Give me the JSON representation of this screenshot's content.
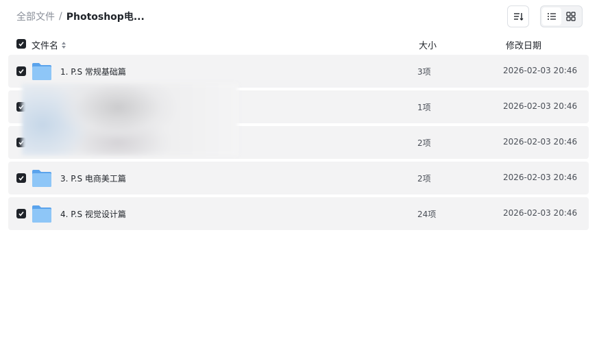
{
  "breadcrumb": {
    "root": "全部文件",
    "separator": "/",
    "current": "Photoshop电..."
  },
  "toolbar": {
    "sort_icon": "sort-icon",
    "list_view_icon": "list-view-icon",
    "grid_view_icon": "grid-view-icon",
    "active_view": "list"
  },
  "columns": {
    "name": "文件名",
    "size": "大小",
    "date": "修改日期"
  },
  "files": [
    {
      "name": "1. P.S 常规基础篇",
      "size": "3项",
      "date": "2026-02-03 20:46",
      "checked": true
    },
    {
      "name": "",
      "size": "1项",
      "date": "2026-02-03 20:46",
      "checked": true
    },
    {
      "name": "",
      "size": "2项",
      "date": "2026-02-03 20:46",
      "checked": true
    },
    {
      "name": "3. P.S 电商美工篇",
      "size": "2项",
      "date": "2026-02-03 20:46",
      "checked": true
    },
    {
      "name": "4. P.S 视觉设计篇",
      "size": "24项",
      "date": "2026-02-03 20:46",
      "checked": true
    }
  ],
  "colors": {
    "folder": "#7cb8f0",
    "row_background": "#f3f3f4",
    "checkbox": "#1f2329"
  }
}
